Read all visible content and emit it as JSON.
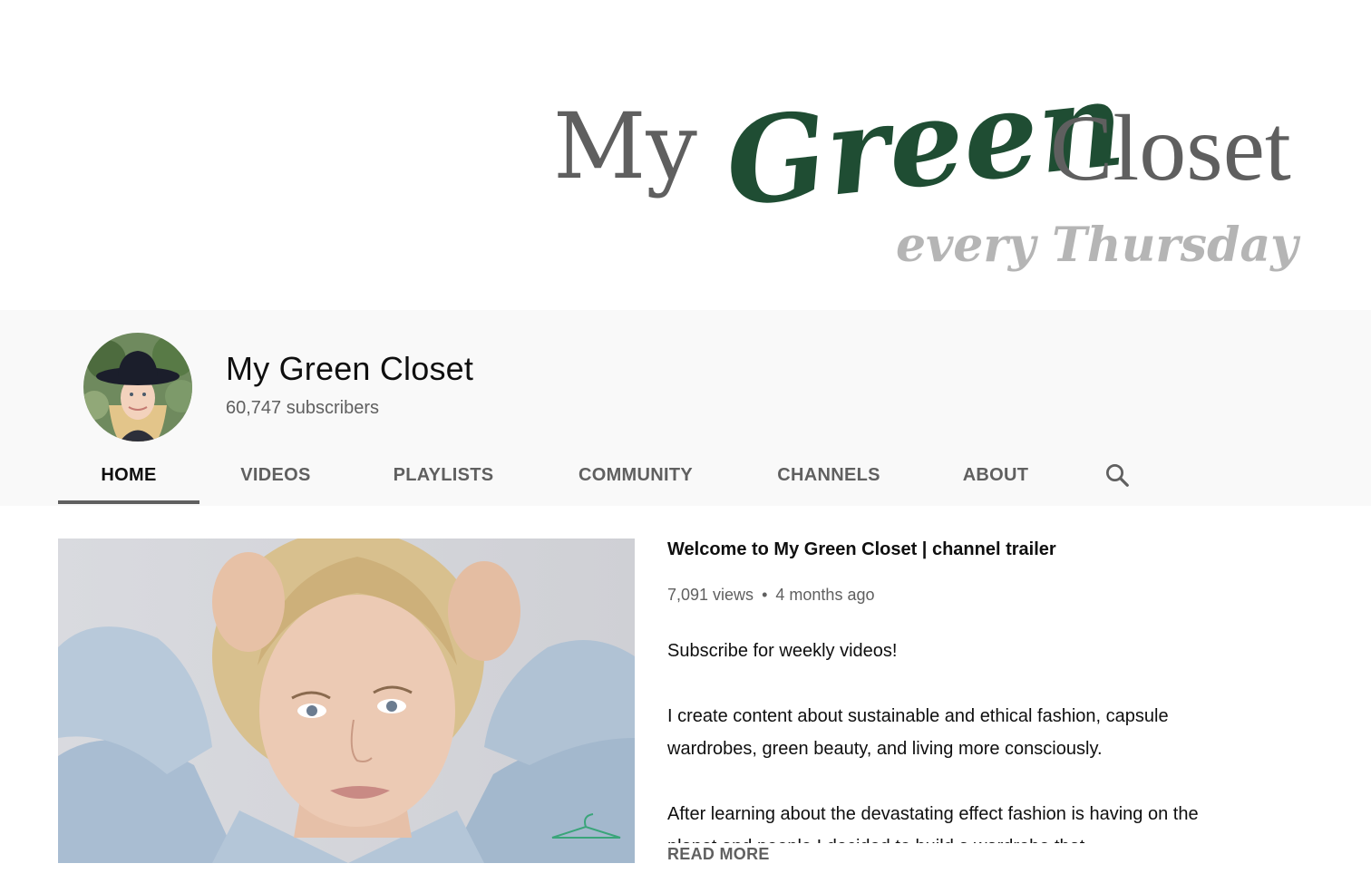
{
  "banner": {
    "word_my": "My",
    "word_green": "Green",
    "word_closet": "Closet",
    "tagline": "every Thursday",
    "colors": {
      "green": "#1f4d33",
      "grey": "#5f5f5f",
      "light_grey": "#b5b5b5"
    }
  },
  "channel": {
    "name": "My Green Closet",
    "subscribers": "60,747 subscribers",
    "avatar_icon": "profile-photo"
  },
  "tabs": [
    {
      "label": "HOME",
      "active": true
    },
    {
      "label": "VIDEOS",
      "active": false
    },
    {
      "label": "PLAYLISTS",
      "active": false
    },
    {
      "label": "COMMUNITY",
      "active": false
    },
    {
      "label": "CHANNELS",
      "active": false
    },
    {
      "label": "ABOUT",
      "active": false
    }
  ],
  "search_icon": "search-icon",
  "featured": {
    "title": "Welcome to My Green Closet | channel trailer",
    "views": "7,091 views",
    "separator": "•",
    "age": "4 months ago",
    "description": [
      "Subscribe for weekly videos!",
      "I create content about sustainable and ethical fashion, capsule wardrobes, green beauty, and living more consciously.",
      "After learning about the devastating effect fashion is having on the planet and people I decided to build a wardrobe that"
    ],
    "read_more": "READ MORE"
  },
  "colors": {
    "header_bg": "#f9f9f9",
    "text_primary": "#0f0f0f",
    "text_secondary": "#606060"
  }
}
